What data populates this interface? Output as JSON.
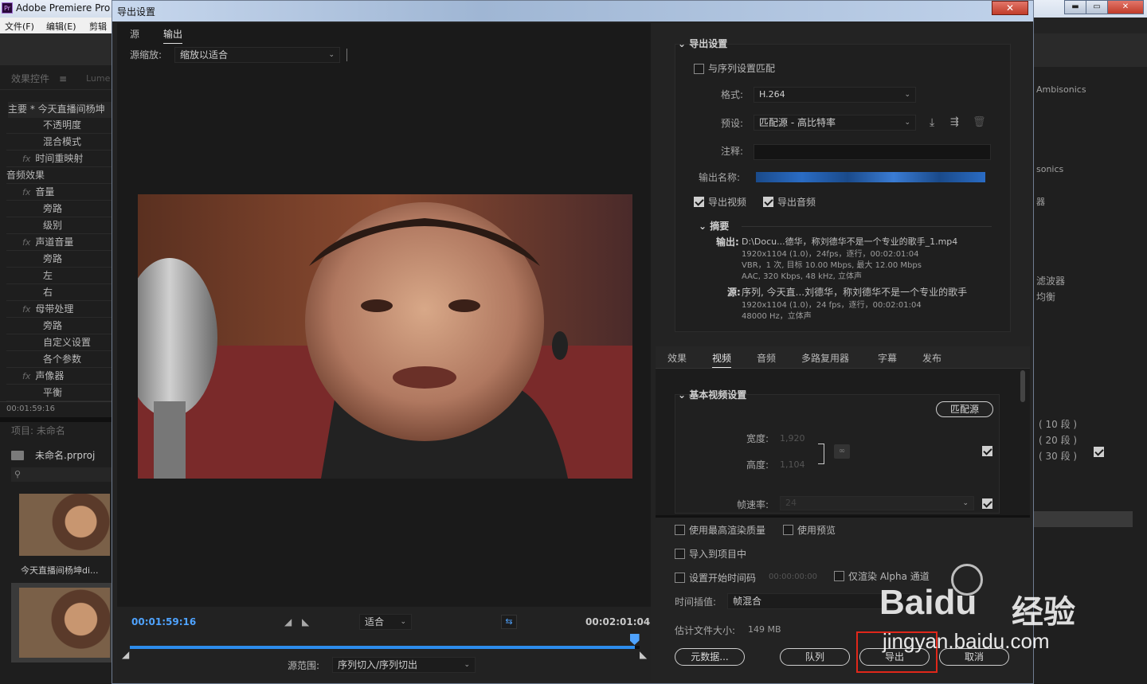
{
  "app": {
    "logo": "Pr",
    "title": "Adobe Premiere Pro",
    "menu": [
      "文件(F)",
      "编辑(E)",
      "剪辑"
    ]
  },
  "window_buttons": {
    "min": "▬",
    "max": "▭",
    "close": "✕"
  },
  "left_panel": {
    "tab_effects": "效果控件",
    "tab_menu": "≡",
    "tab_lumetri": "Lume",
    "clip_header": "主要 * 今天直播间杨坤",
    "rows": [
      {
        "label": "不透明度"
      },
      {
        "label": "混合模式"
      },
      {
        "label": "时间重映射",
        "fx": "fx"
      },
      {
        "label": "音频效果"
      },
      {
        "label": "音量",
        "fx": "fx"
      },
      {
        "label": "旁路"
      },
      {
        "label": "级别"
      },
      {
        "label": "声道音量",
        "fx": "fx"
      },
      {
        "label": "旁路"
      },
      {
        "label": "左"
      },
      {
        "label": "右"
      },
      {
        "label": "母带处理",
        "fx": "fx"
      },
      {
        "label": "旁路"
      },
      {
        "label": "自定义设置"
      },
      {
        "label": "各个参数"
      },
      {
        "label": "声像器",
        "fx": "fx"
      },
      {
        "label": "平衡"
      }
    ],
    "timecode": "00:01:59:16",
    "project_title": "项目: 未命名",
    "project_file": "未命名.prproj",
    "search_icon": "search-icon",
    "thumb_label": "今天直播间杨坤di..."
  },
  "right_background": {
    "items": [
      "Ambisonics",
      "sonics",
      "器",
      "滤波器",
      "均衡",
      "( 10 段 )",
      "( 20 段 )",
      "( 30 段 )"
    ]
  },
  "dialog": {
    "title": "导出设置",
    "close": "✕",
    "tabs": {
      "source": "源",
      "output": "输出"
    },
    "source_scale_label": "源缩放:",
    "source_scale_value": "缩放以适合",
    "timecode_current": "00:01:59:16",
    "timecode_end": "00:02:01:04",
    "fit_value": "适合",
    "source_range_label": "源范围:",
    "source_range_value": "序列切入/序列切出",
    "progress": 0.99,
    "export_settings": {
      "header": "导出设置",
      "match_sequence": "与序列设置匹配",
      "format_label": "格式:",
      "format_value": "H.264",
      "preset_label": "预设:",
      "preset_value": "匹配源 - 高比特率",
      "comment_label": "注释:",
      "output_name_label": "输出名称:",
      "export_video": "导出视频",
      "export_audio": "导出音频",
      "summary_header": "摘要",
      "output_label": "输出:",
      "output_lines": [
        "D:\\Docu...德华，称刘德华不是一个专业的歌手_1.mp4",
        "1920x1104 (1.0)，24fps，逐行，00:02:01:04",
        "VBR，1 次, 目标 10.00 Mbps, 最大 12.00  Mbps",
        "AAC, 320 Kbps, 48  kHz, 立体声"
      ],
      "source_label": "源:",
      "source_lines": [
        "序列, 今天直...刘德华，称刘德华不是一个专业的歌手",
        "1920x1104 (1.0)，24 fps，逐行，00:02:01:04",
        "48000 Hz，立体声"
      ]
    },
    "settings_tabs": [
      "效果",
      "视频",
      "音频",
      "多路复用器",
      "字幕",
      "发布"
    ],
    "video": {
      "header": "基本视频设置",
      "match_source_btn": "匹配源",
      "width_label": "宽度:",
      "width_value": "1,920",
      "height_label": "高度:",
      "height_value": "1,104",
      "fps_label": "帧速率:",
      "fps_value": "24"
    },
    "bottom": {
      "max_render": "使用最高渲染质量",
      "use_preview": "使用预览",
      "import_project": "导入到项目中",
      "set_start_tc": "设置开始时间码",
      "start_tc_value": "00:00:00:00",
      "alpha_only": "仅渲染 Alpha 通道",
      "interp_label": "时间插值:",
      "interp_value": "帧混合",
      "filesize_label": "估计文件大小:",
      "filesize_value": "149 MB",
      "metadata_btn": "元数据...",
      "queue_btn": "队列",
      "export_btn": "导出",
      "cancel_btn": "取消"
    }
  },
  "watermark": {
    "brand": "Baidu",
    "cn": "经验",
    "url": "jingyan.baidu.com"
  }
}
